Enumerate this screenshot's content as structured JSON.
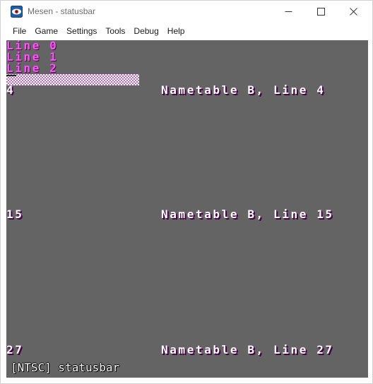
{
  "window": {
    "title": "Mesen - statusbar"
  },
  "menu": {
    "items": [
      "File",
      "Game",
      "Settings",
      "Tools",
      "Debug",
      "Help"
    ]
  },
  "screen": {
    "background": "#646464",
    "magenta_lines": [
      "Line 0",
      "Line 1",
      "Line 2"
    ],
    "rows": [
      {
        "left": "4",
        "right": "Nametable B, Line 4"
      },
      {
        "left": "15",
        "right": "Nametable B, Line 15"
      },
      {
        "left": "27",
        "right": "Nametable B, Line 27"
      }
    ],
    "status_text": "[NTSC] statusbar"
  },
  "colors": {
    "screen_bg": "#646464",
    "magenta_text": "#ff55ff",
    "white_text": "#ffffff"
  },
  "icons": {
    "app": "mesen-eye-icon",
    "minimize": "minimize-icon",
    "maximize": "maximize-icon",
    "close": "close-icon"
  }
}
